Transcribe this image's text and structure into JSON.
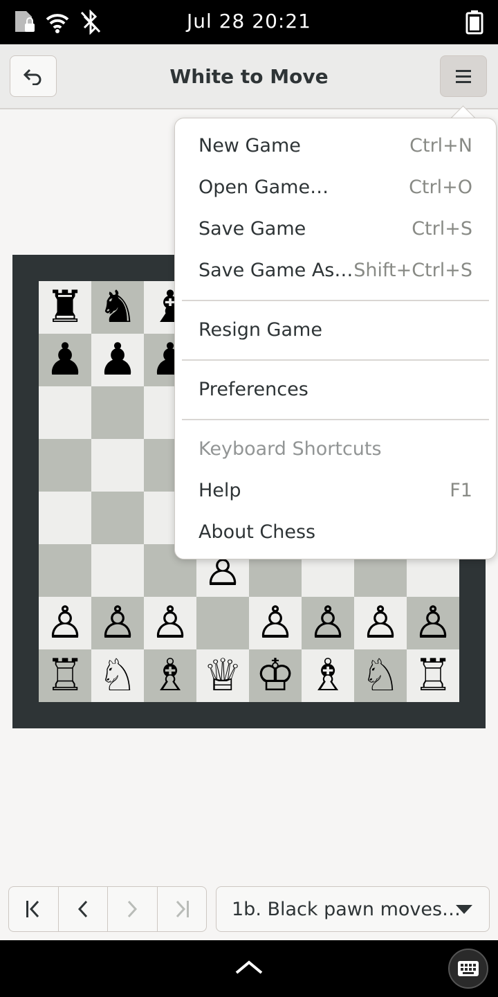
{
  "status": {
    "datetime": "Jul 28  20:21"
  },
  "header": {
    "title": "White to Move"
  },
  "menu": {
    "items": [
      {
        "label": "New Game",
        "accel": "Ctrl+N"
      },
      {
        "label": "Open Game…",
        "accel": "Ctrl+O"
      },
      {
        "label": "Save Game",
        "accel": "Ctrl+S"
      },
      {
        "label": "Save Game As…",
        "accel": "Shift+Ctrl+S"
      },
      {
        "label": "Resign Game",
        "accel": ""
      },
      {
        "label": "Preferences",
        "accel": ""
      },
      {
        "label": "Keyboard Shortcuts",
        "accel": "",
        "disabled": true
      },
      {
        "label": "Help",
        "accel": "F1"
      },
      {
        "label": "About Chess",
        "accel": ""
      }
    ]
  },
  "history": {
    "selected": "1b. Black pawn moves…"
  },
  "board": {
    "rows": [
      [
        "♜",
        "♞",
        "♝",
        "",
        "",
        "",
        "",
        ""
      ],
      [
        "♟",
        "♟",
        "♟",
        "",
        "",
        "",
        "",
        ""
      ],
      [
        "",
        "",
        "",
        "",
        "",
        "",
        "",
        ""
      ],
      [
        "",
        "",
        "",
        "",
        "",
        "",
        "",
        ""
      ],
      [
        "",
        "",
        "",
        "",
        "",
        "",
        "",
        ""
      ],
      [
        "",
        "",
        "",
        "♙",
        "",
        "",
        "",
        ""
      ],
      [
        "♙",
        "♙",
        "♙",
        "",
        "♙",
        "♙",
        "♙",
        "♙"
      ],
      [
        "♖",
        "♘",
        "♗",
        "♕",
        "♔",
        "♗",
        "♘",
        "♖"
      ]
    ]
  },
  "colors": {
    "light_square": "#eeeeec",
    "dark_square": "#babdb6",
    "frame": "#2e3436"
  }
}
